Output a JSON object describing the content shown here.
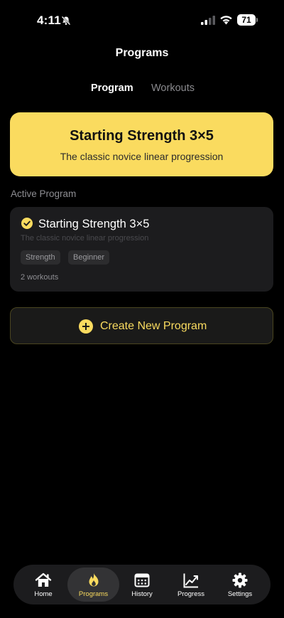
{
  "status_bar": {
    "time": "4:11",
    "battery": "71"
  },
  "header": {
    "title": "Programs"
  },
  "tabs": [
    {
      "label": "Program",
      "active": true
    },
    {
      "label": "Workouts",
      "active": false
    }
  ],
  "hero": {
    "title": "Starting Strength 3×5",
    "subtitle": "The classic novice linear progression"
  },
  "active_program": {
    "section_label": "Active Program",
    "name": "Starting Strength 3×5",
    "description": "The classic novice linear progression",
    "tags": [
      "Strength",
      "Beginner"
    ],
    "workout_count": "2 workouts"
  },
  "create_button": {
    "label": "Create New Program"
  },
  "nav": {
    "items": [
      {
        "label": "Home",
        "icon": "home-icon"
      },
      {
        "label": "Programs",
        "icon": "flame-icon",
        "active": true
      },
      {
        "label": "History",
        "icon": "calendar-icon"
      },
      {
        "label": "Progress",
        "icon": "chart-icon"
      },
      {
        "label": "Settings",
        "icon": "gear-icon"
      }
    ]
  },
  "colors": {
    "accent": "#fadb5f",
    "background": "#000000",
    "card": "#1c1c1e"
  }
}
